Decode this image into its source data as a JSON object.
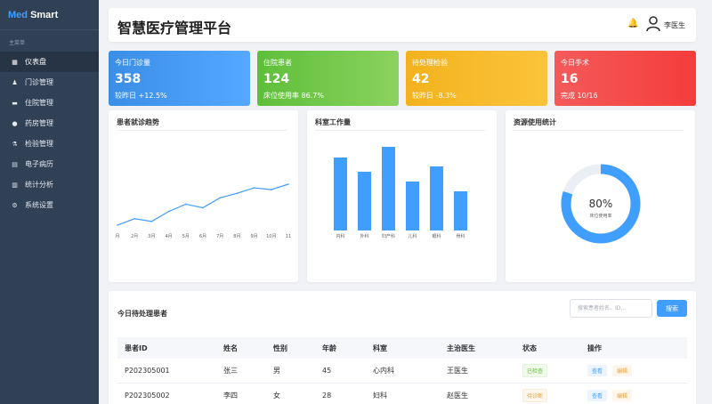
{
  "logo": {
    "part1": "Med",
    "part2": "Smart"
  },
  "sidebar": {
    "section": "主菜单",
    "items": [
      {
        "label": "仪表盘",
        "icon": "dashboard-icon",
        "glyph": "▦"
      },
      {
        "label": "门诊管理",
        "icon": "clinic-icon",
        "glyph": "♟"
      },
      {
        "label": "住院管理",
        "icon": "hospital-bed-icon",
        "glyph": "▬"
      },
      {
        "label": "药房管理",
        "icon": "pill-icon",
        "glyph": "●"
      },
      {
        "label": "检验管理",
        "icon": "microscope-icon",
        "glyph": "⚗"
      },
      {
        "label": "电子病历",
        "icon": "record-icon",
        "glyph": "▤"
      },
      {
        "label": "统计分析",
        "icon": "chart-icon",
        "glyph": "▥"
      },
      {
        "label": "系统设置",
        "icon": "gear-icon",
        "glyph": "⚙"
      }
    ]
  },
  "header": {
    "title": "智慧医疗管理平台",
    "user": "李医生"
  },
  "stats": [
    {
      "label": "今日门诊量",
      "value": "358",
      "sub": "较昨日 +12.5%"
    },
    {
      "label": "住院患者",
      "value": "124",
      "sub": "床位使用率 86.7%"
    },
    {
      "label": "待处理检验",
      "value": "42",
      "sub": "较昨日 -8.3%"
    },
    {
      "label": "今日手术",
      "value": "16",
      "sub": "完成 10/16"
    }
  ],
  "charts": {
    "trend_title": "患者就诊趋势",
    "dept_title": "科室工作量",
    "resource_title": "资源使用统计"
  },
  "chart_data": [
    {
      "type": "line",
      "x": [
        "1月",
        "2月",
        "3月",
        "4月",
        "5月",
        "6月",
        "7月",
        "8月",
        "9月",
        "10月",
        "11月"
      ],
      "x_tick_labels": [
        "月",
        "2月",
        "3月",
        "4月",
        "5月",
        "6月",
        "7月",
        "8月",
        "9月",
        "10月",
        "11"
      ],
      "values": [
        5,
        12,
        9,
        20,
        28,
        24,
        35,
        40,
        46,
        44,
        50
      ],
      "ylim": [
        0,
        100
      ],
      "color": "#409eff",
      "grid": false
    },
    {
      "type": "bar",
      "categories": [
        "内科",
        "外科",
        "妇产科",
        "儿科",
        "眼科",
        "骨科"
      ],
      "values": [
        82,
        66,
        94,
        55,
        72,
        44
      ],
      "ylim": [
        0,
        150
      ],
      "color": "#409eff",
      "grid": false
    },
    {
      "type": "pie",
      "values": [
        80,
        20
      ],
      "center_value": "80%",
      "center_label": "床位使用率",
      "colors": [
        "#409eff",
        "#ebeef5"
      ]
    }
  ],
  "table": {
    "title": "今日待处理患者",
    "search_placeholder": "搜索患者姓名、ID...",
    "search_btn": "搜索",
    "headers": [
      "患者ID",
      "姓名",
      "性别",
      "年龄",
      "科室",
      "主治医生",
      "状态",
      "操作"
    ],
    "rows": [
      {
        "id": "P202305001",
        "name": "张三",
        "sex": "男",
        "age": "45",
        "dept": "心内科",
        "doctor": "王医生",
        "status": "已检查",
        "view": "查看",
        "edit": "编辑"
      },
      {
        "id": "P202305002",
        "name": "李四",
        "sex": "女",
        "age": "28",
        "dept": "妇科",
        "doctor": "赵医生",
        "status": "待诊断",
        "view": "查看",
        "edit": "编辑"
      }
    ]
  },
  "colors": {
    "sidebar_bg": "#304156",
    "primary": "#409eff",
    "success": "#67c23a",
    "warning": "#e6a23c",
    "danger": "#f56c6c"
  }
}
